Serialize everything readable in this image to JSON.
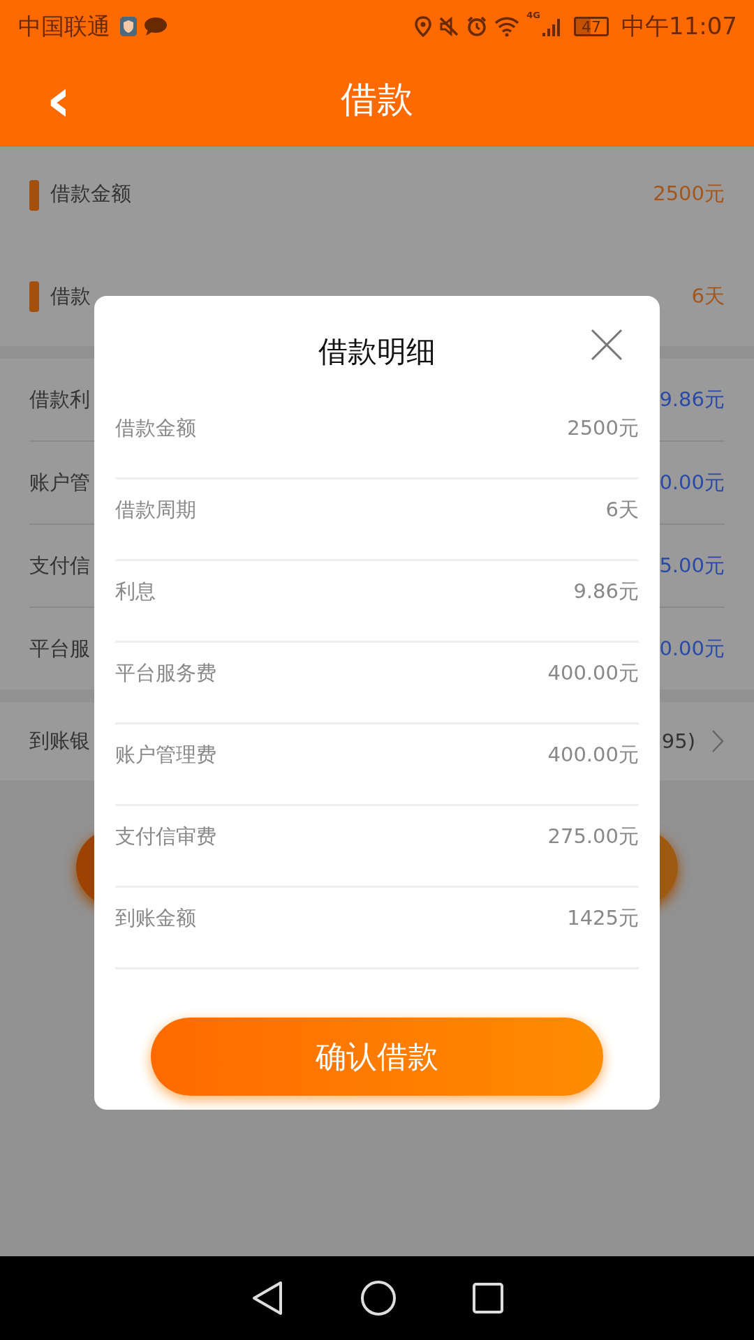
{
  "status_bar": {
    "carrier": "中国联通",
    "battery": "47",
    "time": "中午11:07",
    "network": "4G"
  },
  "header": {
    "back": "‹",
    "title": "借款"
  },
  "loan_settings": [
    {
      "label": "借款金额",
      "value": "2500元"
    },
    {
      "label": "借款",
      "value": "6天"
    }
  ],
  "fees": [
    {
      "label": "借款利",
      "value": "9.86元"
    },
    {
      "label": "账户管",
      "value": "0.00元"
    },
    {
      "label": "支付信",
      "value": "5.00元"
    },
    {
      "label": "平台服",
      "value": "0.00元"
    }
  ],
  "bank": {
    "label": "到账银",
    "value": "95)"
  },
  "dialog": {
    "title": "借款明细",
    "rows": [
      {
        "label": "借款金额",
        "value": "2500元"
      },
      {
        "label": "借款周期",
        "value": "6天"
      },
      {
        "label": "利息",
        "value": "9.86元"
      },
      {
        "label": "平台服务费",
        "value": "400.00元"
      },
      {
        "label": "账户管理费",
        "value": "400.00元"
      },
      {
        "label": "支付信审费",
        "value": "275.00元"
      },
      {
        "label": "到账金额",
        "value": "1425元"
      }
    ],
    "confirm": "确认借款"
  }
}
